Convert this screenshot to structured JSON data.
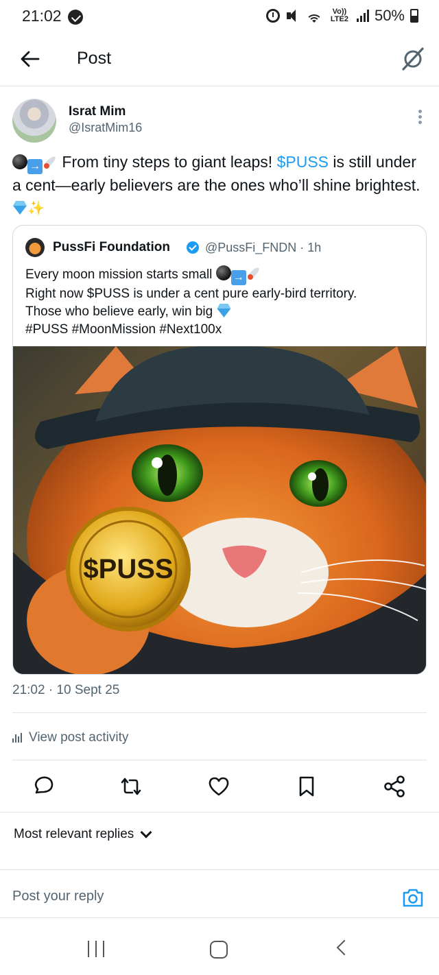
{
  "status_bar": {
    "time": "21:02",
    "network": "Vo)) LTE2",
    "battery": "50%"
  },
  "header": {
    "title": "Post"
  },
  "post": {
    "author_name": "Israt Mim",
    "author_handle": "@IsratMim16",
    "text_part1": " From tiny steps to giant leaps! ",
    "cashtag": "$PUSS",
    "text_part2": " is still under a cent—early believers are the ones who’ll shine brightest. ",
    "timestamp": "21:02 · 10 Sept 25",
    "activity_label": "View post activity"
  },
  "quote": {
    "author_name": "PussFi Foundation",
    "author_handle": "@PussFi_FNDN · 1h",
    "line1": "Every moon mission starts small ",
    "line2": "Right now $PUSS is under a cent pure early-bird territory.",
    "line3": "Those who believe early, win big ",
    "line4": "#PUSS #MoonMission #Next100x",
    "image_coin_text": "$PUSS"
  },
  "replies": {
    "filter_label": "Most relevant replies",
    "input_placeholder": "Post your reply"
  },
  "colors": {
    "accent": "#1d9bf0",
    "text": "#0f1419",
    "secondary": "#536471",
    "divider": "#dfe3e6"
  },
  "icons": {
    "back": "arrow-left-icon",
    "grok": "grok-icon",
    "more": "more-vertical-icon",
    "reply": "comment-icon",
    "repost": "repost-icon",
    "like": "heart-icon",
    "bookmark": "bookmark-icon",
    "share": "share-icon",
    "camera": "camera-icon"
  }
}
